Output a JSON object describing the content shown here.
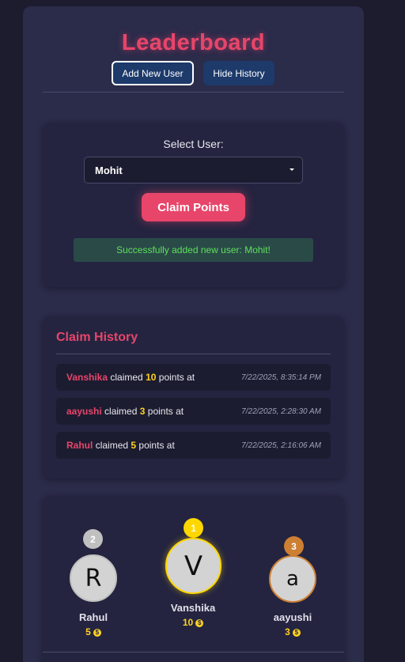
{
  "header": {
    "title": "Leaderboard",
    "add_user_label": "Add New User",
    "hide_history_label": "Hide History"
  },
  "claim": {
    "select_label": "Select User:",
    "selected_user": "Mohit",
    "claim_button_label": "Claim Points",
    "success_message": "Successfully added new user: Mohit!"
  },
  "history": {
    "title": "Claim History",
    "items": [
      {
        "name": "Vanshika",
        "verb": "claimed",
        "points": "10",
        "suffix": "points at",
        "time": "7/22/2025, 8:35:14 PM"
      },
      {
        "name": "aayushi",
        "verb": "claimed",
        "points": "3",
        "suffix": "points at",
        "time": "7/22/2025, 2:28:30 AM"
      },
      {
        "name": "Rahul",
        "verb": "claimed",
        "points": "5",
        "suffix": "points at",
        "time": "7/22/2025, 2:16:06 AM"
      }
    ]
  },
  "podium": [
    {
      "rank": "2",
      "initial": "R",
      "name": "Rahul",
      "score": "5",
      "badge_color": "#c0c0c0"
    },
    {
      "rank": "1",
      "initial": "V",
      "name": "Vanshika",
      "score": "10",
      "badge_color": "#ffd700"
    },
    {
      "rank": "3",
      "initial": "a",
      "name": "aayushi",
      "score": "3",
      "badge_color": "#cd7f32"
    }
  ],
  "colors": {
    "accent": "#e8456a",
    "points": "#ffd21f",
    "success": "#5fe05a"
  }
}
